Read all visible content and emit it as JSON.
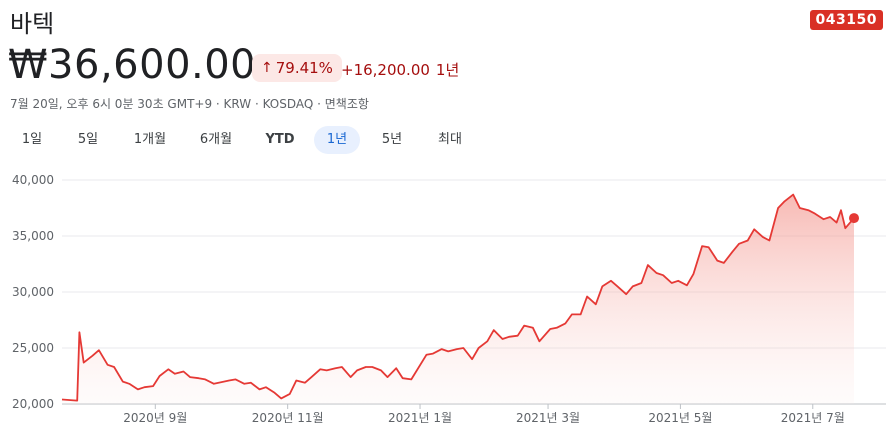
{
  "header": {
    "company": "바텍",
    "ticker": "043150",
    "price": "₩36,600.00",
    "change_pct": "79.41%",
    "change_abs": "+16,200.00",
    "change_period": "1년",
    "meta": "7월 20일, 오후 6시 0분 30초 GMT+9 · KRW · KOSDAQ · 면책조항"
  },
  "tabs": [
    {
      "label": "1일"
    },
    {
      "label": "5일"
    },
    {
      "label": "1개월"
    },
    {
      "label": "6개월"
    },
    {
      "label": "YTD"
    },
    {
      "label": "1년",
      "active": true
    },
    {
      "label": "5년"
    },
    {
      "label": "최대"
    }
  ],
  "colors": {
    "line": "#e53935",
    "fill": "#fbd5d2",
    "accent_red": "#d93025",
    "active_tab": "#1967d2"
  },
  "chart_data": {
    "type": "area",
    "title": "",
    "xlabel": "",
    "ylabel": "",
    "ylim": [
      20000,
      40000
    ],
    "yticks": [
      20000,
      25000,
      30000,
      35000,
      40000
    ],
    "ytick_labels": [
      "20,000",
      "25,000",
      "30,000",
      "35,000",
      "40,000"
    ],
    "xticks": [
      {
        "label": "2020년 9월",
        "date": "2020-09-01"
      },
      {
        "label": "2020년 11월",
        "date": "2020-11-01"
      },
      {
        "label": "2021년 1월",
        "date": "2021-01-01"
      },
      {
        "label": "2021년 3월",
        "date": "2021-03-01"
      },
      {
        "label": "2021년 5월",
        "date": "2021-05-01"
      },
      {
        "label": "2021년 7월",
        "date": "2021-07-01"
      }
    ],
    "grid": true,
    "series": [
      {
        "x": [
          "2020-07-20",
          "2020-07-27",
          "2020-07-28",
          "2020-07-30",
          "2020-08-03",
          "2020-08-06",
          "2020-08-10",
          "2020-08-13",
          "2020-08-17",
          "2020-08-20",
          "2020-08-24",
          "2020-08-27",
          "2020-08-31",
          "2020-09-03",
          "2020-09-07",
          "2020-09-10",
          "2020-09-14",
          "2020-09-17",
          "2020-09-21",
          "2020-09-24",
          "2020-09-28",
          "2020-10-05",
          "2020-10-08",
          "2020-10-12",
          "2020-10-15",
          "2020-10-19",
          "2020-10-22",
          "2020-10-26",
          "2020-10-29",
          "2020-11-02",
          "2020-11-05",
          "2020-11-09",
          "2020-11-12",
          "2020-11-16",
          "2020-11-19",
          "2020-11-23",
          "2020-11-26",
          "2020-11-30",
          "2020-12-03",
          "2020-12-07",
          "2020-12-10",
          "2020-12-14",
          "2020-12-17",
          "2020-12-21",
          "2020-12-24",
          "2020-12-28",
          "2021-01-04",
          "2021-01-07",
          "2021-01-11",
          "2021-01-14",
          "2021-01-18",
          "2021-01-21",
          "2021-01-25",
          "2021-01-28",
          "2021-02-01",
          "2021-02-04",
          "2021-02-08",
          "2021-02-11",
          "2021-02-15",
          "2021-02-18",
          "2021-02-22",
          "2021-02-25",
          "2021-03-02",
          "2021-03-05",
          "2021-03-09",
          "2021-03-12",
          "2021-03-16",
          "2021-03-19",
          "2021-03-23",
          "2021-03-26",
          "2021-03-30",
          "2021-04-02",
          "2021-04-06",
          "2021-04-09",
          "2021-04-13",
          "2021-04-16",
          "2021-04-20",
          "2021-04-23",
          "2021-04-27",
          "2021-04-30",
          "2021-05-04",
          "2021-05-07",
          "2021-05-11",
          "2021-05-14",
          "2021-05-18",
          "2021-05-21",
          "2021-05-25",
          "2021-05-28",
          "2021-06-01",
          "2021-06-04",
          "2021-06-08",
          "2021-06-11",
          "2021-06-15",
          "2021-06-18",
          "2021-06-22",
          "2021-06-25",
          "2021-06-29",
          "2021-07-02",
          "2021-07-06",
          "2021-07-09",
          "2021-07-12",
          "2021-07-14",
          "2021-07-16",
          "2021-07-20"
        ],
        "y": [
          20400,
          20300,
          26400,
          23700,
          24300,
          24800,
          23500,
          23300,
          22000,
          21800,
          21300,
          21500,
          21600,
          22500,
          23100,
          22700,
          22900,
          22400,
          22300,
          22200,
          21800,
          22100,
          22200,
          21800,
          21900,
          21300,
          21500,
          21000,
          20500,
          20900,
          22100,
          21900,
          22400,
          23100,
          23000,
          23200,
          23300,
          22400,
          23000,
          23300,
          23300,
          23000,
          22400,
          23200,
          22300,
          22200,
          24400,
          24500,
          24900,
          24700,
          24900,
          25000,
          24000,
          25000,
          25600,
          26600,
          25800,
          26000,
          26100,
          27000,
          26800,
          25600,
          26700,
          26800,
          27200,
          28000,
          28000,
          29600,
          28900,
          30500,
          31000,
          30500,
          29800,
          30500,
          30800,
          32400,
          31700,
          31500,
          30800,
          31000,
          30600,
          31600,
          34100,
          34000,
          32800,
          32600,
          33600,
          34300,
          34600,
          35600,
          34900,
          34600,
          37500,
          38100,
          38700,
          37500,
          37300,
          37000,
          36500,
          36700,
          36200,
          37300,
          35700,
          36600
        ]
      }
    ],
    "last_point": {
      "date": "2021-07-20",
      "value": 36600
    }
  }
}
